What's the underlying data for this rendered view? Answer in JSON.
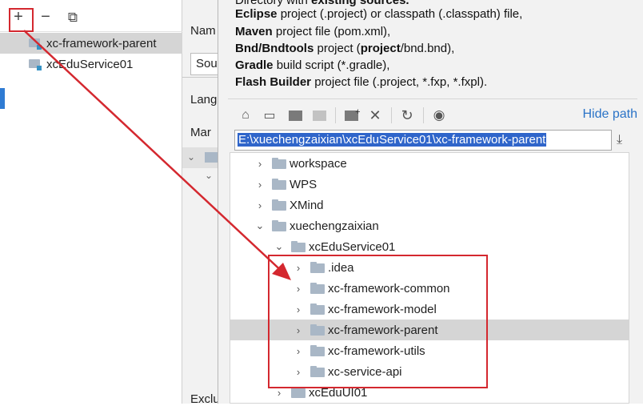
{
  "left_pane": {
    "toolbar": {
      "add": "+",
      "remove": "−",
      "copy": "⧉"
    },
    "modules": [
      {
        "label": "xc-framework-parent",
        "selected": true
      },
      {
        "label": "xcEduService01",
        "selected": false
      }
    ]
  },
  "middle": {
    "name_label": "Nam",
    "sources_box": "Sou",
    "lang_label": "Lang",
    "mark_label": "Mar",
    "exclude_label": "Exclu"
  },
  "dialog": {
    "desc_top": "Directory with ",
    "desc_top_bold": "existing sources.",
    "desc_lines": [
      {
        "bold": "Eclipse",
        "rest": " project (.project) or classpath (.classpath) file,"
      },
      {
        "bold": "Maven",
        "rest": " project file (pom.xml),"
      },
      {
        "bold": "Bnd/Bndtools",
        "rest": " project (",
        "bold2": "project",
        "rest2": "/bnd.bnd),"
      },
      {
        "bold": "Gradle",
        "rest": " build script (*.gradle),"
      },
      {
        "bold": "Flash Builder",
        "rest": " project file (.project, *.fxp, *.fxpl)."
      }
    ],
    "toolbar_icons": [
      "home-icon",
      "desktop-icon",
      "project-folder-icon",
      "module-folder-icon",
      "new-folder-icon",
      "delete-icon",
      "refresh-icon",
      "show-hidden-icon"
    ],
    "hide_path": "Hide path",
    "path_value": "E:\\xuechengzaixian\\xcEduService01\\xc-framework-parent",
    "tree": [
      {
        "label": "workspace",
        "indent": 0,
        "expanded": false
      },
      {
        "label": "WPS",
        "indent": 0,
        "expanded": false
      },
      {
        "label": "XMind",
        "indent": 0,
        "expanded": false
      },
      {
        "label": "xuechengzaixian",
        "indent": 0,
        "expanded": true
      },
      {
        "label": "xcEduService01",
        "indent": 1,
        "expanded": true
      },
      {
        "label": ".idea",
        "indent": 2,
        "expanded": false
      },
      {
        "label": "xc-framework-common",
        "indent": 2,
        "expanded": false
      },
      {
        "label": "xc-framework-model",
        "indent": 2,
        "expanded": false
      },
      {
        "label": "xc-framework-parent",
        "indent": 2,
        "expanded": false,
        "selected": true
      },
      {
        "label": "xc-framework-utils",
        "indent": 2,
        "expanded": false
      },
      {
        "label": "xc-service-api",
        "indent": 2,
        "expanded": false
      },
      {
        "label": "xcEduUI01",
        "indent": 1,
        "expanded": false
      }
    ]
  },
  "colors": {
    "annotation_red": "#d4282f",
    "link_blue": "#2a73c7",
    "selection_blue": "#2f65ca"
  }
}
